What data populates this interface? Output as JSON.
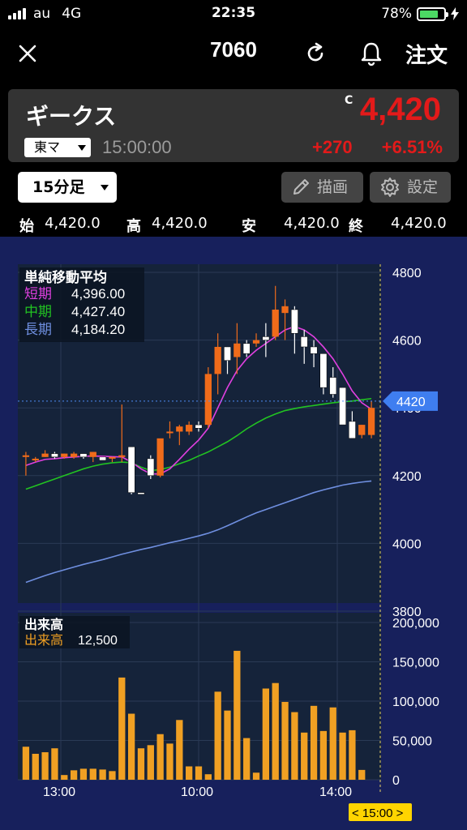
{
  "status_bar": {
    "carrier": "au",
    "network": "4G",
    "time": "22:35",
    "battery": "78%",
    "battery_level": 0.78
  },
  "nav": {
    "title": "7060",
    "order_label": "注文"
  },
  "stock": {
    "name": "ギークス",
    "price_flag": "C",
    "price": "4,420",
    "market": "東マ",
    "time": "15:00:00",
    "change": "+270",
    "change_pct": "+6.51%",
    "up_color": "#e31a1a"
  },
  "toolbar": {
    "period": "15分足",
    "draw_label": "描画",
    "settings_label": "設定"
  },
  "ohlc": {
    "open_label": "始",
    "open": "4,420.0",
    "high_label": "高",
    "high": "4,420.0",
    "low_label": "安",
    "low": "4,420.0",
    "close_label": "終",
    "close": "4,420.0"
  },
  "chart_data": [
    {
      "type": "candlestick",
      "title": "単純移動平均",
      "legend": [
        {
          "name": "短期",
          "value": "4,396.00",
          "color": "#e040e0"
        },
        {
          "name": "中期",
          "value": "4,427.40",
          "color": "#22c322"
        },
        {
          "name": "長期",
          "value": "4,184.20",
          "color": "#6f8fe0"
        }
      ],
      "y_ticks": [
        "4800",
        "4600",
        "4400",
        "4200",
        "4000",
        "3800"
      ],
      "ylim": [
        3800,
        4800
      ],
      "current_price_tag": "4420",
      "x_ticks": [
        "13:00",
        "10:00",
        "14:00"
      ],
      "current_time_tag": "< 15:00 >",
      "candles": [
        {
          "o": 4255,
          "h": 4270,
          "l": 4200,
          "c": 4260
        },
        {
          "o": 4245,
          "h": 4255,
          "l": 4240,
          "c": 4250
        },
        {
          "o": 4255,
          "h": 4275,
          "l": 4255,
          "c": 4265
        },
        {
          "o": 4265,
          "h": 4270,
          "l": 4250,
          "c": 4255
        },
        {
          "o": 4255,
          "h": 4265,
          "l": 4250,
          "c": 4265
        },
        {
          "o": 4255,
          "h": 4270,
          "l": 4250,
          "c": 4265
        },
        {
          "o": 4265,
          "h": 4265,
          "l": 4250,
          "c": 4255
        },
        {
          "o": 4255,
          "h": 4270,
          "l": 4240,
          "c": 4270
        },
        {
          "o": 4255,
          "h": 4255,
          "l": 4245,
          "c": 4245
        },
        {
          "o": 4250,
          "h": 4255,
          "l": 4240,
          "c": 4255
        },
        {
          "o": 4255,
          "h": 4410,
          "l": 4240,
          "c": 4260
        },
        {
          "o": 4285,
          "h": 4285,
          "l": 4145,
          "c": 4150
        },
        {
          "o": 4150,
          "h": 4150,
          "l": 4145,
          "c": 4145
        },
        {
          "o": 4250,
          "h": 4260,
          "l": 4190,
          "c": 4200
        },
        {
          "o": 4200,
          "h": 4290,
          "l": 4195,
          "c": 4310
        },
        {
          "o": 4330,
          "h": 4360,
          "l": 4310,
          "c": 4330
        },
        {
          "o": 4330,
          "h": 4350,
          "l": 4290,
          "c": 4345
        },
        {
          "o": 4330,
          "h": 4360,
          "l": 4320,
          "c": 4350
        },
        {
          "o": 4350,
          "h": 4360,
          "l": 4330,
          "c": 4340
        },
        {
          "o": 4350,
          "h": 4520,
          "l": 4340,
          "c": 4500
        },
        {
          "o": 4500,
          "h": 4620,
          "l": 4440,
          "c": 4580
        },
        {
          "o": 4580,
          "h": 4580,
          "l": 4500,
          "c": 4540
        },
        {
          "o": 4550,
          "h": 4650,
          "l": 4500,
          "c": 4590
        },
        {
          "o": 4590,
          "h": 4600,
          "l": 4550,
          "c": 4560
        },
        {
          "o": 4590,
          "h": 4620,
          "l": 4580,
          "c": 4600
        },
        {
          "o": 4610,
          "h": 4650,
          "l": 4550,
          "c": 4600
        },
        {
          "o": 4610,
          "h": 4760,
          "l": 4600,
          "c": 4690
        },
        {
          "o": 4680,
          "h": 4720,
          "l": 4600,
          "c": 4700
        },
        {
          "o": 4690,
          "h": 4700,
          "l": 4560,
          "c": 4620
        },
        {
          "o": 4610,
          "h": 4630,
          "l": 4530,
          "c": 4580
        },
        {
          "o": 4580,
          "h": 4600,
          "l": 4520,
          "c": 4560
        },
        {
          "o": 4560,
          "h": 4560,
          "l": 4440,
          "c": 4460
        },
        {
          "o": 4490,
          "h": 4520,
          "l": 4430,
          "c": 4440
        },
        {
          "o": 4460,
          "h": 4460,
          "l": 4350,
          "c": 4350
        },
        {
          "o": 4360,
          "h": 4390,
          "l": 4310,
          "c": 4310
        },
        {
          "o": 4320,
          "h": 4350,
          "l": 4310,
          "c": 4350
        },
        {
          "o": 4320,
          "h": 4420,
          "l": 4310,
          "c": 4400
        }
      ],
      "sma_short": [
        4230,
        4240,
        4248,
        4250,
        4253,
        4255,
        4257,
        4258,
        4257,
        4256,
        4255,
        4240,
        4220,
        4205,
        4205,
        4220,
        4248,
        4278,
        4305,
        4340,
        4400,
        4460,
        4510,
        4545,
        4570,
        4590,
        4610,
        4630,
        4640,
        4630,
        4610,
        4580,
        4545,
        4500,
        4450,
        4415,
        4396
      ],
      "sma_mid": [
        4160,
        4170,
        4180,
        4190,
        4200,
        4210,
        4220,
        4228,
        4234,
        4238,
        4240,
        4238,
        4225,
        4215,
        4218,
        4225,
        4235,
        4245,
        4258,
        4270,
        4285,
        4300,
        4318,
        4338,
        4355,
        4370,
        4382,
        4392,
        4398,
        4403,
        4407,
        4411,
        4415,
        4418,
        4420,
        4424,
        4427.4
      ],
      "sma_long": [
        3885,
        3895,
        3905,
        3914,
        3922,
        3930,
        3938,
        3945,
        3952,
        3960,
        3968,
        3975,
        3982,
        3988,
        3995,
        4002,
        4008,
        4015,
        4022,
        4030,
        4040,
        4052,
        4065,
        4078,
        4090,
        4100,
        4110,
        4120,
        4130,
        4140,
        4150,
        4158,
        4165,
        4172,
        4177,
        4181,
        4184.2
      ]
    },
    {
      "type": "bar",
      "title": "出来高",
      "legend": [
        {
          "name": "出来高",
          "value": "12,500",
          "color": "#f0a023"
        }
      ],
      "y_ticks": [
        "200,000",
        "150,000",
        "100,000",
        "50,000",
        "0"
      ],
      "ylim": [
        0,
        200000
      ],
      "values": [
        42000,
        33000,
        35000,
        40000,
        6000,
        12000,
        14000,
        14000,
        13000,
        11000,
        130000,
        84000,
        40000,
        44000,
        58000,
        46000,
        76000,
        17000,
        17000,
        7000,
        112000,
        88000,
        164000,
        53000,
        9000,
        116000,
        123000,
        99000,
        86000,
        60000,
        94000,
        62000,
        92000,
        60000,
        63000,
        12500
      ]
    }
  ]
}
